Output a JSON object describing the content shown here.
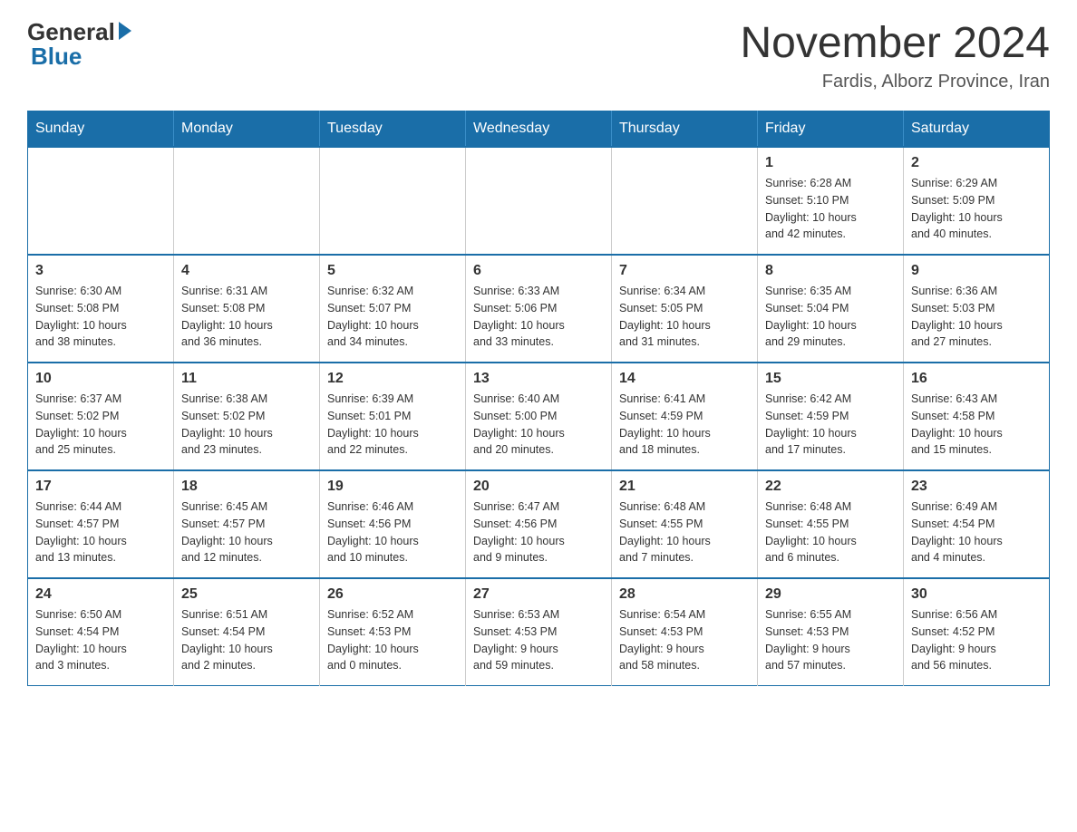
{
  "logo": {
    "general": "General",
    "blue": "Blue"
  },
  "title": "November 2024",
  "location": "Fardis, Alborz Province, Iran",
  "days_of_week": [
    "Sunday",
    "Monday",
    "Tuesday",
    "Wednesday",
    "Thursday",
    "Friday",
    "Saturday"
  ],
  "weeks": [
    [
      {
        "day": "",
        "info": ""
      },
      {
        "day": "",
        "info": ""
      },
      {
        "day": "",
        "info": ""
      },
      {
        "day": "",
        "info": ""
      },
      {
        "day": "",
        "info": ""
      },
      {
        "day": "1",
        "info": "Sunrise: 6:28 AM\nSunset: 5:10 PM\nDaylight: 10 hours\nand 42 minutes."
      },
      {
        "day": "2",
        "info": "Sunrise: 6:29 AM\nSunset: 5:09 PM\nDaylight: 10 hours\nand 40 minutes."
      }
    ],
    [
      {
        "day": "3",
        "info": "Sunrise: 6:30 AM\nSunset: 5:08 PM\nDaylight: 10 hours\nand 38 minutes."
      },
      {
        "day": "4",
        "info": "Sunrise: 6:31 AM\nSunset: 5:08 PM\nDaylight: 10 hours\nand 36 minutes."
      },
      {
        "day": "5",
        "info": "Sunrise: 6:32 AM\nSunset: 5:07 PM\nDaylight: 10 hours\nand 34 minutes."
      },
      {
        "day": "6",
        "info": "Sunrise: 6:33 AM\nSunset: 5:06 PM\nDaylight: 10 hours\nand 33 minutes."
      },
      {
        "day": "7",
        "info": "Sunrise: 6:34 AM\nSunset: 5:05 PM\nDaylight: 10 hours\nand 31 minutes."
      },
      {
        "day": "8",
        "info": "Sunrise: 6:35 AM\nSunset: 5:04 PM\nDaylight: 10 hours\nand 29 minutes."
      },
      {
        "day": "9",
        "info": "Sunrise: 6:36 AM\nSunset: 5:03 PM\nDaylight: 10 hours\nand 27 minutes."
      }
    ],
    [
      {
        "day": "10",
        "info": "Sunrise: 6:37 AM\nSunset: 5:02 PM\nDaylight: 10 hours\nand 25 minutes."
      },
      {
        "day": "11",
        "info": "Sunrise: 6:38 AM\nSunset: 5:02 PM\nDaylight: 10 hours\nand 23 minutes."
      },
      {
        "day": "12",
        "info": "Sunrise: 6:39 AM\nSunset: 5:01 PM\nDaylight: 10 hours\nand 22 minutes."
      },
      {
        "day": "13",
        "info": "Sunrise: 6:40 AM\nSunset: 5:00 PM\nDaylight: 10 hours\nand 20 minutes."
      },
      {
        "day": "14",
        "info": "Sunrise: 6:41 AM\nSunset: 4:59 PM\nDaylight: 10 hours\nand 18 minutes."
      },
      {
        "day": "15",
        "info": "Sunrise: 6:42 AM\nSunset: 4:59 PM\nDaylight: 10 hours\nand 17 minutes."
      },
      {
        "day": "16",
        "info": "Sunrise: 6:43 AM\nSunset: 4:58 PM\nDaylight: 10 hours\nand 15 minutes."
      }
    ],
    [
      {
        "day": "17",
        "info": "Sunrise: 6:44 AM\nSunset: 4:57 PM\nDaylight: 10 hours\nand 13 minutes."
      },
      {
        "day": "18",
        "info": "Sunrise: 6:45 AM\nSunset: 4:57 PM\nDaylight: 10 hours\nand 12 minutes."
      },
      {
        "day": "19",
        "info": "Sunrise: 6:46 AM\nSunset: 4:56 PM\nDaylight: 10 hours\nand 10 minutes."
      },
      {
        "day": "20",
        "info": "Sunrise: 6:47 AM\nSunset: 4:56 PM\nDaylight: 10 hours\nand 9 minutes."
      },
      {
        "day": "21",
        "info": "Sunrise: 6:48 AM\nSunset: 4:55 PM\nDaylight: 10 hours\nand 7 minutes."
      },
      {
        "day": "22",
        "info": "Sunrise: 6:48 AM\nSunset: 4:55 PM\nDaylight: 10 hours\nand 6 minutes."
      },
      {
        "day": "23",
        "info": "Sunrise: 6:49 AM\nSunset: 4:54 PM\nDaylight: 10 hours\nand 4 minutes."
      }
    ],
    [
      {
        "day": "24",
        "info": "Sunrise: 6:50 AM\nSunset: 4:54 PM\nDaylight: 10 hours\nand 3 minutes."
      },
      {
        "day": "25",
        "info": "Sunrise: 6:51 AM\nSunset: 4:54 PM\nDaylight: 10 hours\nand 2 minutes."
      },
      {
        "day": "26",
        "info": "Sunrise: 6:52 AM\nSunset: 4:53 PM\nDaylight: 10 hours\nand 0 minutes."
      },
      {
        "day": "27",
        "info": "Sunrise: 6:53 AM\nSunset: 4:53 PM\nDaylight: 9 hours\nand 59 minutes."
      },
      {
        "day": "28",
        "info": "Sunrise: 6:54 AM\nSunset: 4:53 PM\nDaylight: 9 hours\nand 58 minutes."
      },
      {
        "day": "29",
        "info": "Sunrise: 6:55 AM\nSunset: 4:53 PM\nDaylight: 9 hours\nand 57 minutes."
      },
      {
        "day": "30",
        "info": "Sunrise: 6:56 AM\nSunset: 4:52 PM\nDaylight: 9 hours\nand 56 minutes."
      }
    ]
  ]
}
